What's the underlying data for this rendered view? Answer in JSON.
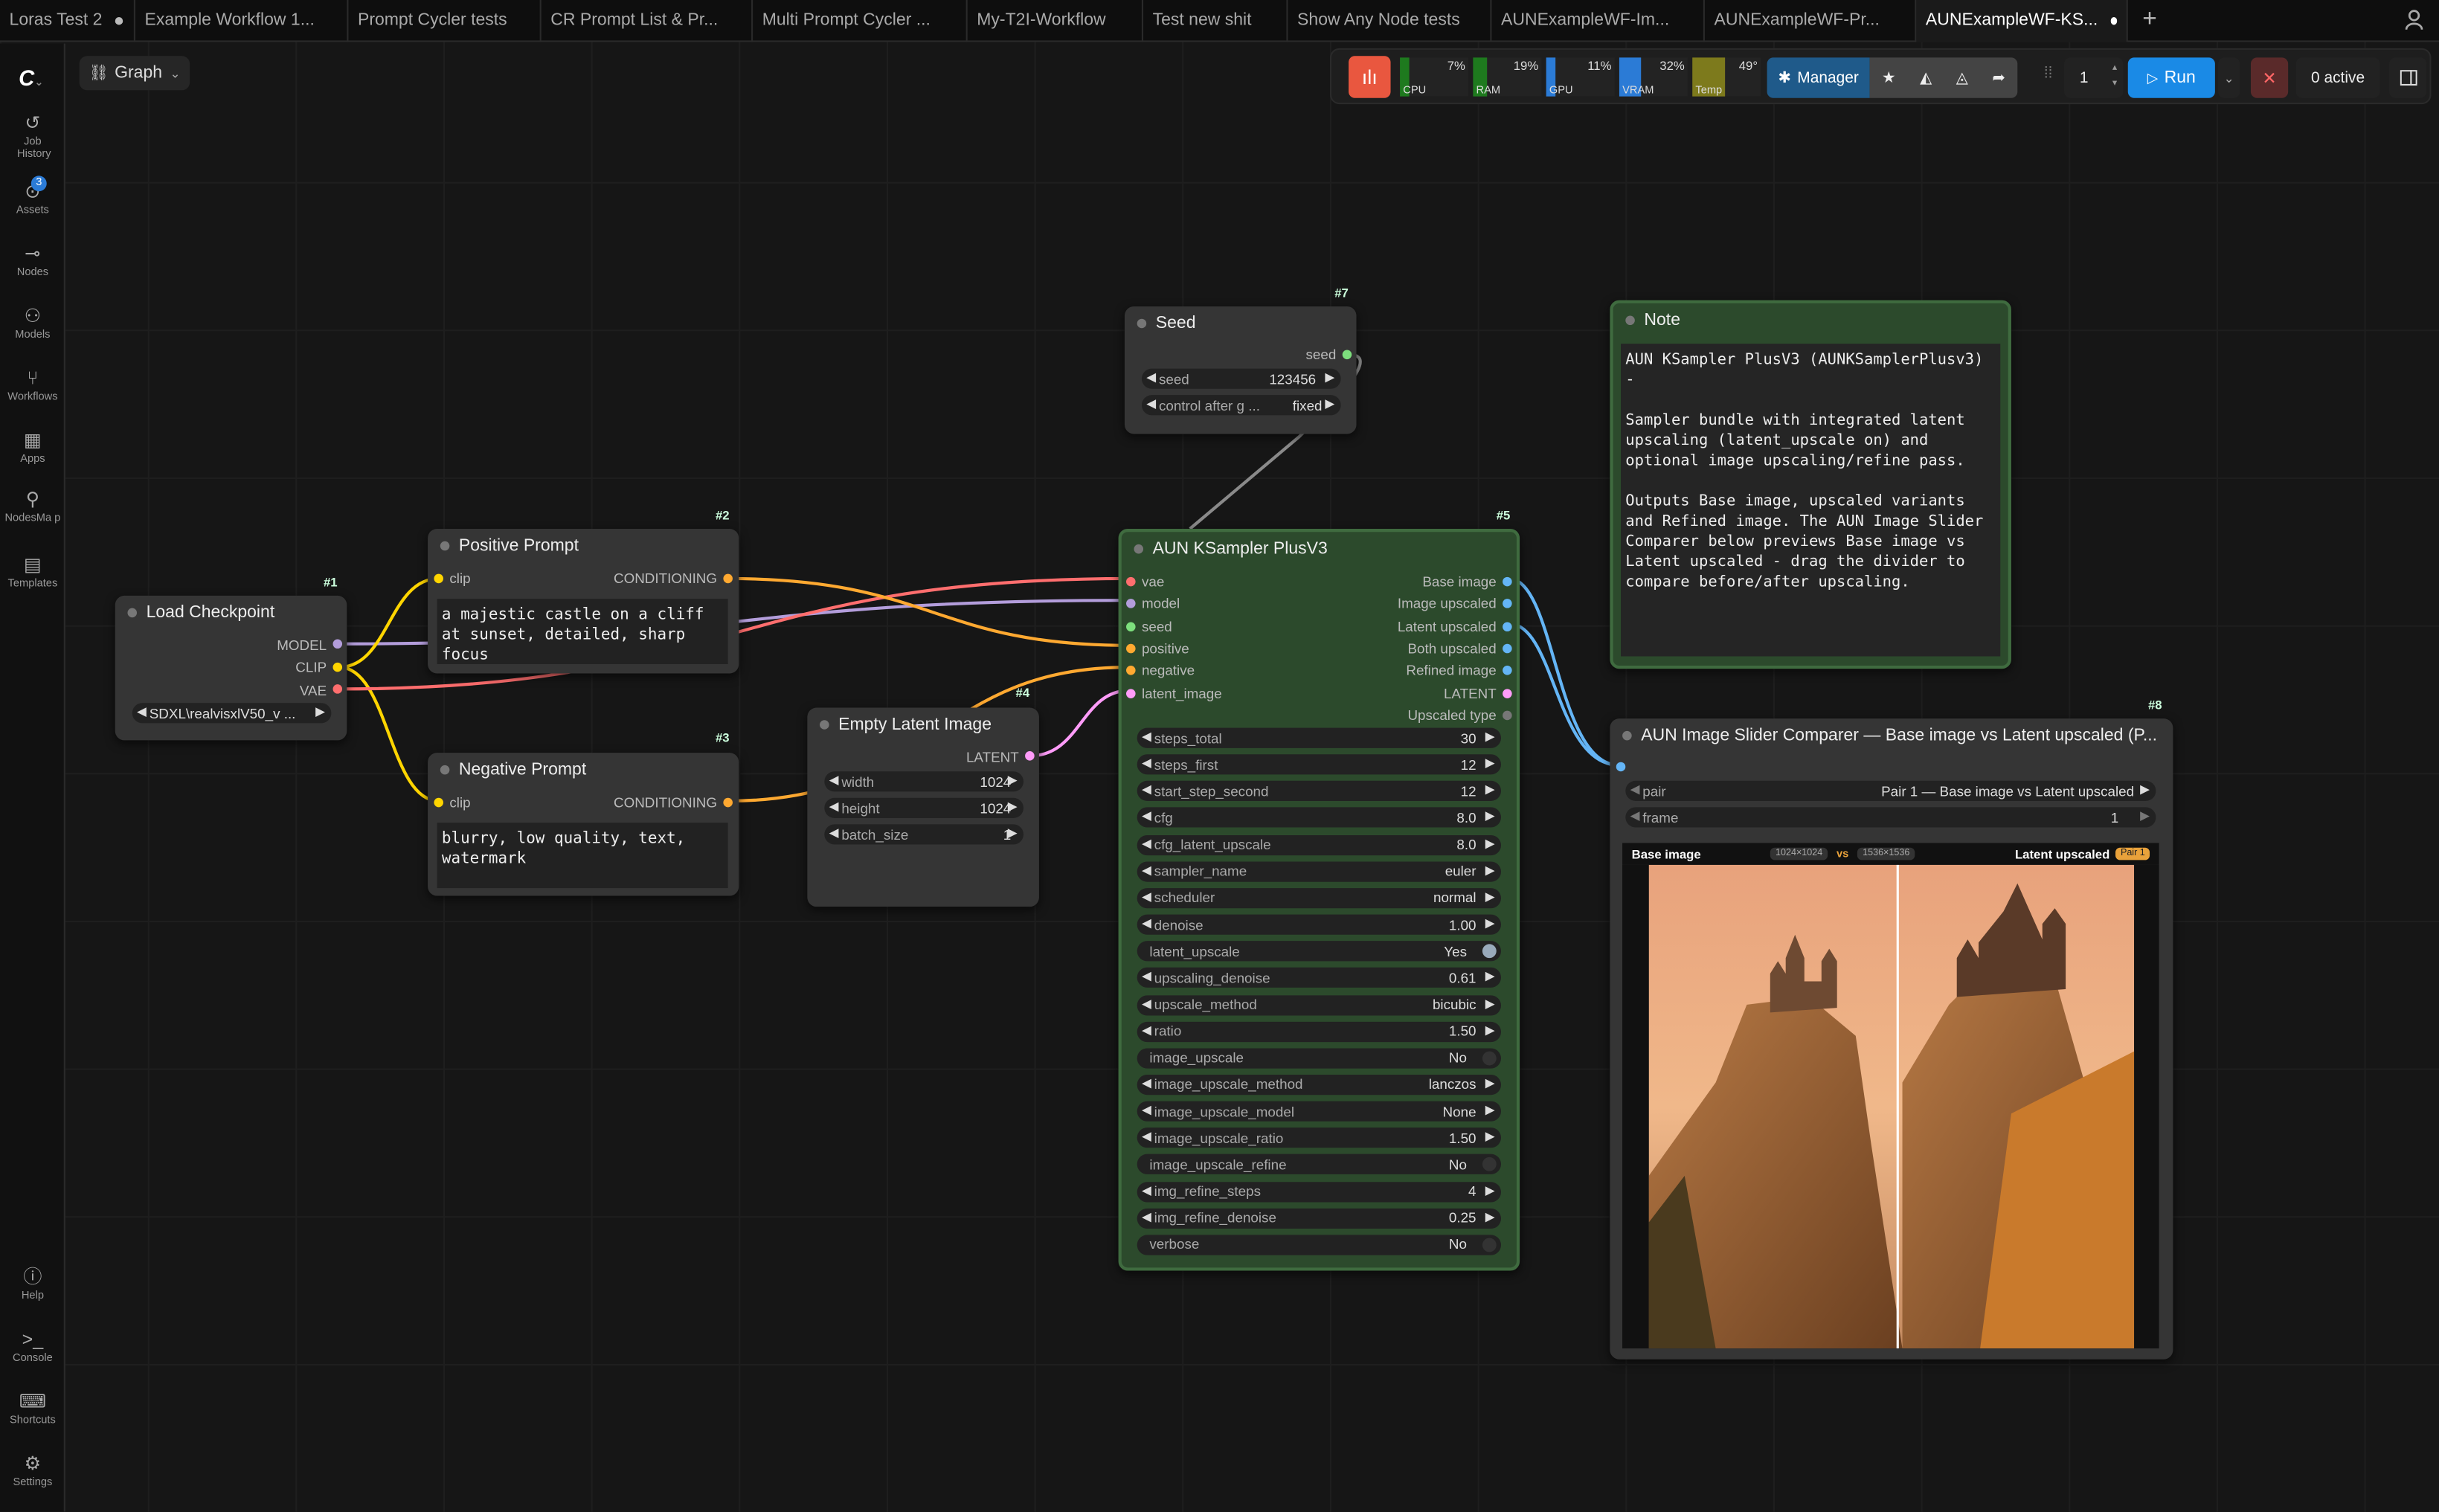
{
  "tabs": [
    {
      "label": "Loras Test 2",
      "modified": true
    },
    {
      "label": "Example Workflow 1..."
    },
    {
      "label": "Prompt Cycler tests"
    },
    {
      "label": "CR Prompt List & Pr..."
    },
    {
      "label": "Multi Prompt Cycler ..."
    },
    {
      "label": "My-T2I-Workflow"
    },
    {
      "label": "Test new shit"
    },
    {
      "label": "Show Any Node tests"
    },
    {
      "label": "AUNExampleWF-Im..."
    },
    {
      "label": "AUNExampleWF-Pr..."
    },
    {
      "label": "AUNExampleWF-KS...",
      "active": true,
      "modified": true
    }
  ],
  "sidebar": {
    "job_history": "Job History",
    "assets": "Assets",
    "assets_badge": "3",
    "nodes": "Nodes",
    "models": "Models",
    "workflows": "Workflows",
    "apps": "Apps",
    "nodesmap": "NodesMa p",
    "templates": "Templates",
    "help": "Help",
    "console": "Console",
    "shortcuts": "Shortcuts",
    "settings": "Settings"
  },
  "graph_button": "Graph",
  "monitor": {
    "cpu": "7%",
    "cpu_label": "CPU",
    "ram": "19%",
    "ram_label": "RAM",
    "gpu": "11%",
    "gpu_label": "GPU",
    "vram": "32%",
    "vram_label": "VRAM",
    "temp": "49°",
    "temp_label": "Temp"
  },
  "toolbar": {
    "manager": "Manager",
    "batch_count": "1",
    "run": "Run",
    "active": "0 active"
  },
  "colors": {
    "model": "#b39ddb",
    "clip": "#ffd500",
    "vae": "#ff6e6e",
    "conditioning": "#ffa931",
    "latent": "#ff9cf9",
    "image": "#64b5f6",
    "int": "#7ddf7d"
  },
  "nodes": {
    "load_checkpoint": {
      "id": "#1",
      "title": "Load Checkpoint",
      "out_model": "MODEL",
      "out_clip": "CLIP",
      "out_vae": "VAE",
      "ckpt": "SDXL\\realvisxlV50_v ..."
    },
    "positive": {
      "id": "#2",
      "title": "Positive Prompt",
      "in_clip": "clip",
      "out": "CONDITIONING",
      "text": "a majestic castle on a cliff at sunset, detailed, sharp focus"
    },
    "negative": {
      "id": "#3",
      "title": "Negative Prompt",
      "in_clip": "clip",
      "out": "CONDITIONING",
      "text": "blurry, low quality, text, watermark"
    },
    "empty_latent": {
      "id": "#4",
      "title": "Empty Latent Image",
      "out": "LATENT",
      "width_label": "width",
      "width": "1024",
      "height_label": "height",
      "height": "1024",
      "batch_label": "batch_size",
      "batch": "1"
    },
    "seed": {
      "id": "#7",
      "title": "Seed",
      "out": "seed",
      "seed_label": "seed",
      "seed_value": "123456",
      "control_label": "control after g ...",
      "control_value": "fixed"
    },
    "ksampler": {
      "id": "#5",
      "title": "AUN KSampler PlusV3",
      "inputs": [
        "vae",
        "model",
        "seed",
        "positive",
        "negative",
        "latent_image"
      ],
      "outputs": [
        "Base image",
        "Image upscaled",
        "Latent upscaled",
        "Both upscaled",
        "Refined image",
        "LATENT",
        "Upscaled type"
      ],
      "widgets": [
        {
          "label": "steps_total",
          "value": "30"
        },
        {
          "label": "steps_first",
          "value": "12"
        },
        {
          "label": "start_step_second",
          "value": "12"
        },
        {
          "label": "cfg",
          "value": "8.0"
        },
        {
          "label": "cfg_latent_upscale",
          "value": "8.0"
        },
        {
          "label": "sampler_name",
          "value": "euler"
        },
        {
          "label": "scheduler",
          "value": "normal"
        },
        {
          "label": "denoise",
          "value": "1.00"
        },
        {
          "label": "latent_upscale",
          "value": "Yes",
          "toggle": true
        },
        {
          "label": "upscaling_denoise",
          "value": "0.61"
        },
        {
          "label": "upscale_method",
          "value": "bicubic"
        },
        {
          "label": "ratio",
          "value": "1.50"
        },
        {
          "label": "image_upscale",
          "value": "No",
          "toggle": true
        },
        {
          "label": "image_upscale_method",
          "value": "lanczos"
        },
        {
          "label": "image_upscale_model",
          "value": "None"
        },
        {
          "label": "image_upscale_ratio",
          "value": "1.50"
        },
        {
          "label": "image_upscale_refine",
          "value": "No",
          "toggle": true
        },
        {
          "label": "img_refine_steps",
          "value": "4"
        },
        {
          "label": "img_refine_denoise",
          "value": "0.25"
        },
        {
          "label": "verbose",
          "value": "No",
          "toggle": true
        }
      ]
    },
    "note": {
      "title": "Note",
      "text": "AUN KSampler PlusV3 (AUNKSamplerPlusv3)\n-\n\nSampler bundle with integrated latent\nupscaling (latent_upscale on) and\noptional image upscaling/refine pass.\n\nOutputs Base image, upscaled variants\nand Refined image. The AUN Image Slider\nComparer below previews Base image vs\nLatent upscaled - drag the divider to\ncompare before/after upscaling."
    },
    "slider": {
      "id": "#8",
      "title": "AUN Image Slider Comparer — Base image vs Latent upscaled (P...",
      "pair_label": "pair",
      "pair_value": "Pair 1 — Base image vs Latent upscaled",
      "frame_label": "frame",
      "frame_value": "1",
      "left_label": "Base image",
      "left_size": "1024×1024",
      "vs": "vs",
      "right_size": "1536×1536",
      "right_label": "Latent upscaled",
      "pair_badge": "Pair 1"
    }
  }
}
